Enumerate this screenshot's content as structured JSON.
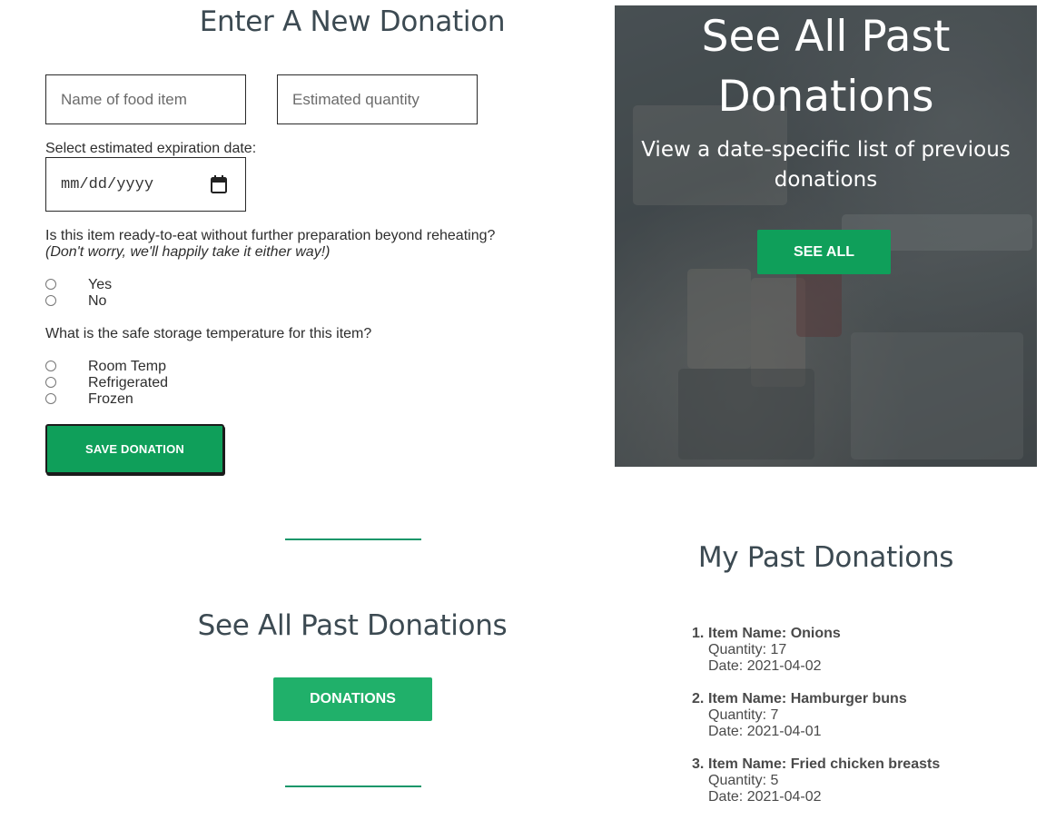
{
  "form": {
    "title": "Enter A New Donation",
    "food_name_placeholder": "Name of food item",
    "quantity_placeholder": "Estimated quantity",
    "date_label": "Select estimated expiration date:",
    "date_placeholder": "mm/dd/yyyy",
    "ready_question": "Is this item ready-to-eat without further preparation beyond reheating?",
    "ready_note": "(Don't worry, we'll happily take it either way!)",
    "ready_options": [
      "Yes",
      "No"
    ],
    "temp_question": "What is the safe storage temperature for this item?",
    "temp_options": [
      "Room Temp",
      "Refrigerated",
      "Frozen"
    ],
    "save_label": "SAVE DONATION"
  },
  "hero": {
    "title": "See All Past Donations",
    "subtitle": "View a date-specific list of previous donations",
    "button_label": "SEE ALL"
  },
  "past_section": {
    "title": "See All Past Donations",
    "button_label": "DONATIONS"
  },
  "my_past": {
    "title": "My Past Donations",
    "items": [
      {
        "num": "1.",
        "name": "Item Name: Onions",
        "quantity": "Quantity: 17",
        "date": "Date: 2021-04-02"
      },
      {
        "num": "2.",
        "name": "Item Name: Hamburger buns",
        "quantity": "Quantity: 7",
        "date": "Date: 2021-04-01"
      },
      {
        "num": "3.",
        "name": "Item Name: Fried chicken breasts",
        "quantity": "Quantity: 5",
        "date": "Date: 2021-04-02"
      }
    ]
  },
  "colors": {
    "accent_green": "#0f9f5a",
    "heading_gray": "#3c4a52"
  }
}
